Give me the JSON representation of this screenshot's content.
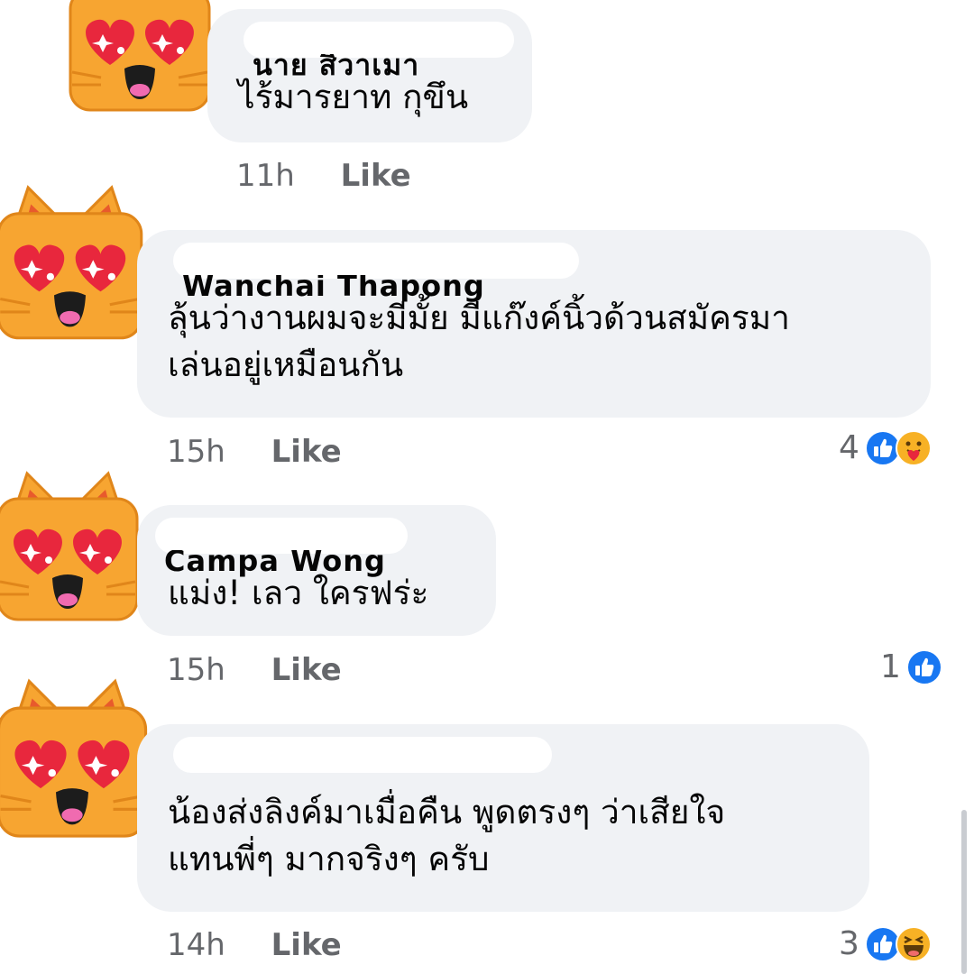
{
  "comments": [
    {
      "author": "นาย สิวาเมา",
      "text_lines": [
        "ไร้มารยาท กุขึน"
      ],
      "time": "11h",
      "like_label": "Like",
      "reaction_count": null,
      "reactions": []
    },
    {
      "author": "Wanchai Thapong",
      "text_lines": [
        "ลุ้นว่างานผมจะมีมั้ย มีแก๊งค์นิ้วด้วนสมัครมา",
        "เล่นอยู่เหมือนกัน"
      ],
      "time": "15h",
      "like_label": "Like",
      "reaction_count": "4",
      "reactions": [
        "like-icon",
        "care-icon"
      ]
    },
    {
      "author": "Campa Wong",
      "text_lines": [
        "แม่ง! เลว ใครฟร่ะ"
      ],
      "time": "15h",
      "like_label": "Like",
      "reaction_count": "1",
      "reactions": [
        "like-icon"
      ]
    },
    {
      "author": "",
      "text_lines": [
        "น้องส่งลิงค์มาเมื่อคืน พูดตรงๆ ว่าเสียใจ",
        "แทนพี่ๆ มากจริงๆ ครับ"
      ],
      "time": "14h",
      "like_label": "Like",
      "reaction_count": "3",
      "reactions": [
        "like-icon",
        "haha-icon"
      ]
    }
  ],
  "colors": {
    "bubble_bg": "#f0f2f5",
    "meta_text": "#65676b",
    "like_blue": "#1877f2",
    "cat_orange": "#f5a623",
    "heart_red": "#e8273d"
  }
}
